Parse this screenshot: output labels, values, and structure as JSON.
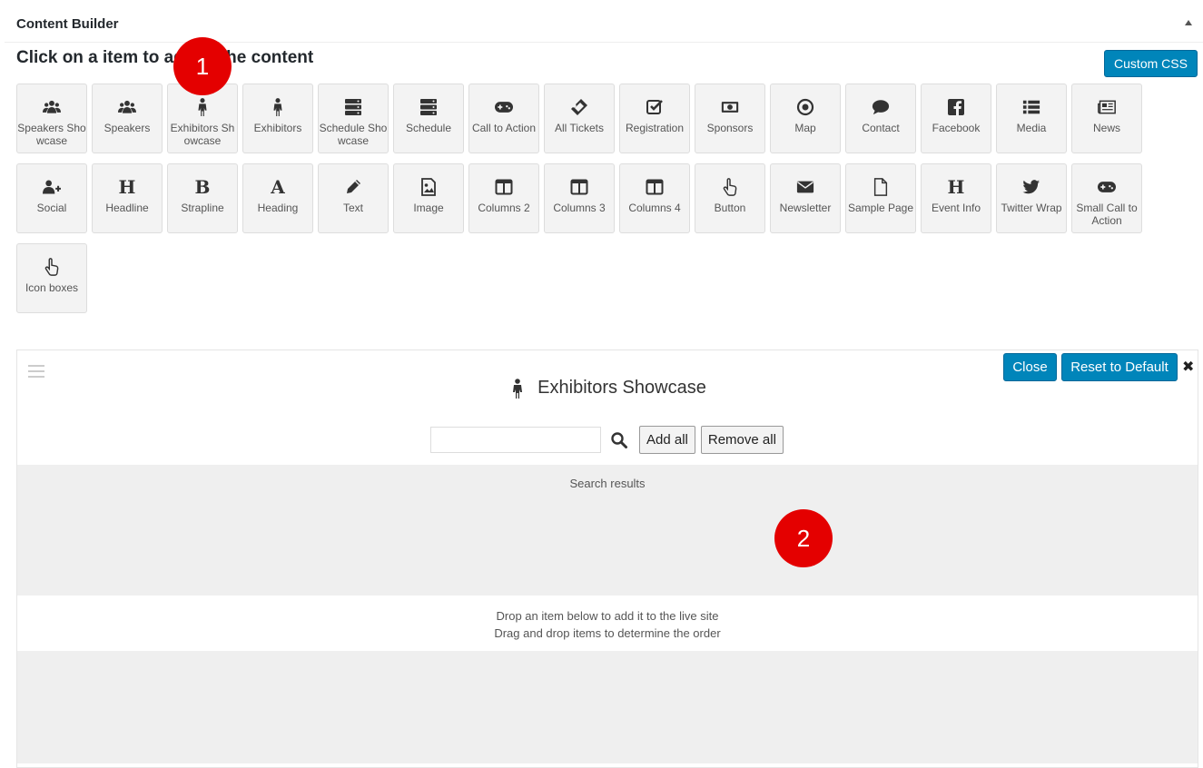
{
  "panel": {
    "title": "Content Builder"
  },
  "instruction": "Click on a item to add to the content",
  "custom_css_label": "Custom CSS",
  "badges": [
    "1",
    "2"
  ],
  "tiles": [
    {
      "label": "Speakers Showcase",
      "icon": "users-icon"
    },
    {
      "label": "Speakers",
      "icon": "users-icon"
    },
    {
      "label": "Exhibitors Showcase",
      "icon": "male-icon"
    },
    {
      "label": "Exhibitors",
      "icon": "male-icon"
    },
    {
      "label": "Schedule Showcase",
      "icon": "server-icon"
    },
    {
      "label": "Schedule",
      "icon": "server-icon"
    },
    {
      "label": "Call to Action",
      "icon": "gamepad-icon"
    },
    {
      "label": "All Tickets",
      "icon": "ticket-icon"
    },
    {
      "label": "Registration",
      "icon": "check-square-icon"
    },
    {
      "label": "Sponsors",
      "icon": "money-icon"
    },
    {
      "label": "Map",
      "icon": "dot-circle-icon"
    },
    {
      "label": "Contact",
      "icon": "comment-icon"
    },
    {
      "label": "Facebook",
      "icon": "facebook-icon"
    },
    {
      "label": "Media",
      "icon": "list-icon"
    },
    {
      "label": "News",
      "icon": "newspaper-icon"
    },
    {
      "label": "Social",
      "icon": "user-plus-icon"
    },
    {
      "label": "Headline",
      "icon": "h-icon",
      "glyph": "H"
    },
    {
      "label": "Strapline",
      "icon": "b-icon",
      "glyph": "B"
    },
    {
      "label": "Heading",
      "icon": "a-icon",
      "glyph": "A"
    },
    {
      "label": "Text",
      "icon": "pencil-icon"
    },
    {
      "label": "Image",
      "icon": "image-icon"
    },
    {
      "label": "Columns 2",
      "icon": "columns-icon"
    },
    {
      "label": "Columns 3",
      "icon": "columns-icon"
    },
    {
      "label": "Columns 4",
      "icon": "columns-icon"
    },
    {
      "label": "Button",
      "icon": "hand-pointer-icon"
    },
    {
      "label": "Newsletter",
      "icon": "envelope-icon"
    },
    {
      "label": "Sample Page",
      "icon": "file-icon"
    },
    {
      "label": "Event Info",
      "icon": "h-icon",
      "glyph": "H"
    },
    {
      "label": "Twitter Wrap",
      "icon": "twitter-icon"
    },
    {
      "label": "Small Call to Action",
      "icon": "gamepad-icon"
    },
    {
      "label": "Icon boxes",
      "icon": "hand-pointer-icon"
    }
  ],
  "editor": {
    "title": "Exhibitors Showcase",
    "close_label": "Close",
    "reset_label": "Reset to Default",
    "close_x": "✖",
    "search_value": "",
    "add_all_label": "Add all",
    "remove_all_label": "Remove all",
    "results_label": "Search results",
    "drop_line1": "Drop an item below to add it to the live site",
    "drop_line2": "Drag and drop items to determine the order"
  }
}
